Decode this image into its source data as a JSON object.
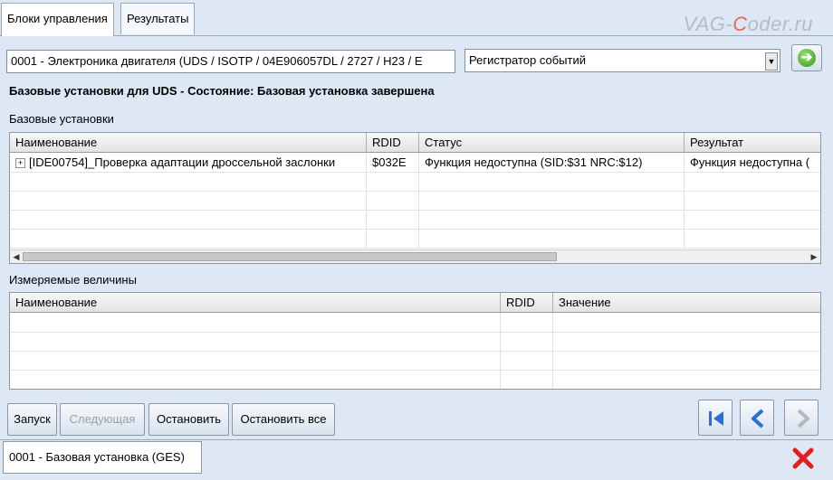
{
  "tabs": [
    {
      "label": "Блоки управления",
      "active": true
    },
    {
      "label": "Результаты",
      "active": false
    }
  ],
  "watermark": {
    "part1": "VAG-",
    "part2": "C",
    "part3": "oder.ru"
  },
  "ecu_selector": {
    "value": "0001 - Электроника двигателя  (UDS / ISOTP / 04E906057DL / 2727 / H23 / E"
  },
  "mode_combo": {
    "selected": "Регистратор событий"
  },
  "status_line": "Базовые установки для UDS - Состояние: Базовая установка завершена",
  "basic_settings": {
    "section_label": "Базовые установки",
    "columns": [
      "Наименование",
      "RDID",
      "Статус",
      "Результат"
    ],
    "rows": [
      {
        "name": "[IDE00754]_Проверка адаптации дроссельной заслонки",
        "rdid": "$032E",
        "status": "Функция недоступна (SID:$31 NRC:$12)",
        "result": "Функция недоступна ("
      }
    ]
  },
  "measured_values": {
    "section_label": "Измеряемые величины",
    "columns": [
      "Наименование",
      "RDID",
      "Значение"
    ]
  },
  "buttons": {
    "start": "Запуск",
    "next": "Следующая",
    "stop": "Остановить",
    "stop_all": "Остановить все"
  },
  "bottom_tab": {
    "label": "0001 - Базовая установка (GES)"
  },
  "colors": {
    "accent_blue": "#2b6fd6",
    "close_red": "#e02020",
    "go_green": "#2f9a1c"
  }
}
